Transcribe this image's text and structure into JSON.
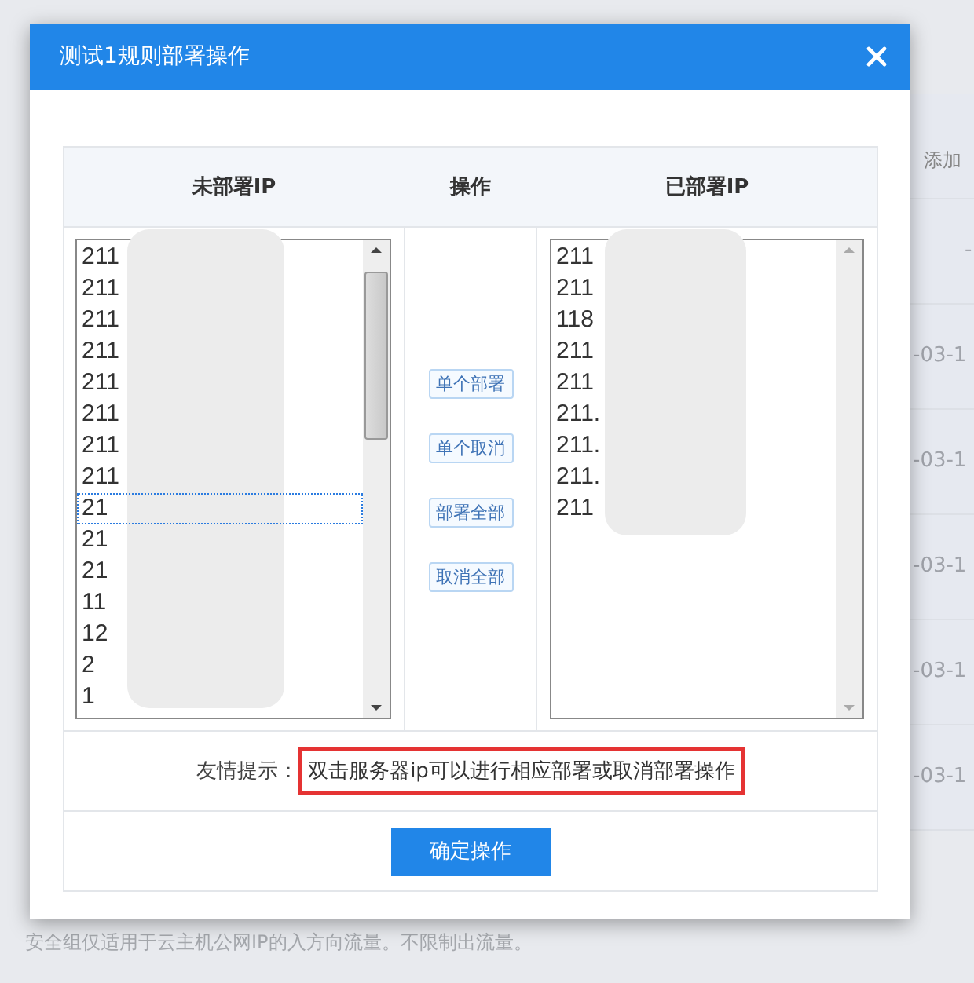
{
  "background": {
    "column_header": "添加",
    "rows": [
      "-",
      "-03-1",
      "-03-1",
      "-03-1",
      "-03-1",
      "-03-1"
    ],
    "footnote": "安全组仅适用于云主机公网IP的入方向流量。不限制出流量。"
  },
  "dialog": {
    "title": "测试1规则部署操作",
    "columns": [
      "未部署IP",
      "操作",
      "已部署IP"
    ],
    "undeployed": [
      {
        "text": "211",
        "focused": false
      },
      {
        "text": "211",
        "focused": false
      },
      {
        "text": "211",
        "focused": false
      },
      {
        "text": "211",
        "focused": false
      },
      {
        "text": "211",
        "focused": false
      },
      {
        "text": "211",
        "focused": false
      },
      {
        "text": "211",
        "focused": false
      },
      {
        "text": "211",
        "focused": false
      },
      {
        "text": "21",
        "focused": true
      },
      {
        "text": "21",
        "focused": false
      },
      {
        "text": "21",
        "focused": false
      },
      {
        "text": "11",
        "focused": false
      },
      {
        "text": "12",
        "focused": false
      },
      {
        "text": "2",
        "focused": false
      },
      {
        "text": "1",
        "focused": false
      }
    ],
    "deployed": [
      "211",
      "211",
      "118",
      "211",
      "211",
      "211.",
      "211.",
      "211.",
      "211"
    ],
    "actions": [
      "单个部署",
      "单个取消",
      "部署全部",
      "取消全部"
    ],
    "tip_label": "友情提示：",
    "tip": "双击服务器ip可以进行相应部署或取消部署操作",
    "confirm": "确定操作"
  }
}
